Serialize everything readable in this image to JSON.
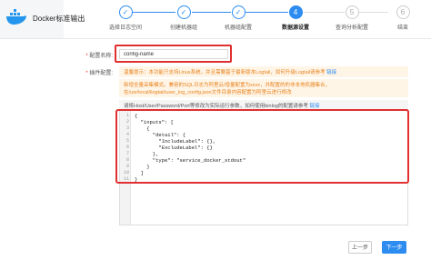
{
  "app": {
    "title": "Docker标准输出"
  },
  "steps": [
    {
      "label": "选择日志空间",
      "state": "done",
      "mark": "✓"
    },
    {
      "label": "创建机器组",
      "state": "done",
      "mark": "✓"
    },
    {
      "label": "机器组配置",
      "state": "done",
      "mark": "✓"
    },
    {
      "label": "数据源设置",
      "state": "active",
      "mark": "4"
    },
    {
      "label": "查询分析配置",
      "state": "todo",
      "mark": "5"
    },
    {
      "label": "结束",
      "state": "todo",
      "mark": "6"
    }
  ],
  "form": {
    "name_label": "配置名称:",
    "name_value": "config-name",
    "plugin_label": "插件配置:",
    "required_mark": "*"
  },
  "notices": {
    "line1_text": "温馨提示：本功能只支持Linux系统，并且需要基于最新版本Logtail，如何升级Logtail请参考",
    "line1_link": "链接",
    "line2_text": "新增全量采集模式。兼容的SQL日志为阿里云/增量配置为xxxx，并配置的的非本地机器集合，在/usr/local/ilogtail/user_log_config.json文件目录内容配置为阿里云进行修改"
  },
  "help": {
    "text": "请将Host/User/Password/Port等修改为实际运行参数，如何使用binlog的配置请参考",
    "link": "链接"
  },
  "editor": {
    "lines": [
      "{",
      "  \"inputs\": [",
      "    {",
      "      \"detail\": {",
      "        \"IncludeLabel\": {},",
      "        \"ExcludeLabel\": {}",
      "      },",
      "      \"type\": \"service_docker_stdout\"",
      "    }",
      "  ]",
      "}"
    ],
    "line_numbers": [
      "1",
      "2",
      "3",
      "4",
      "5",
      "6",
      "7",
      "8",
      "9",
      "10",
      "11"
    ]
  },
  "buttons": {
    "prev": "上一步",
    "next": "下一步"
  },
  "colors": {
    "accent": "#2d8cf0",
    "highlight": "#e03030",
    "notice_text": "#e8821e"
  }
}
